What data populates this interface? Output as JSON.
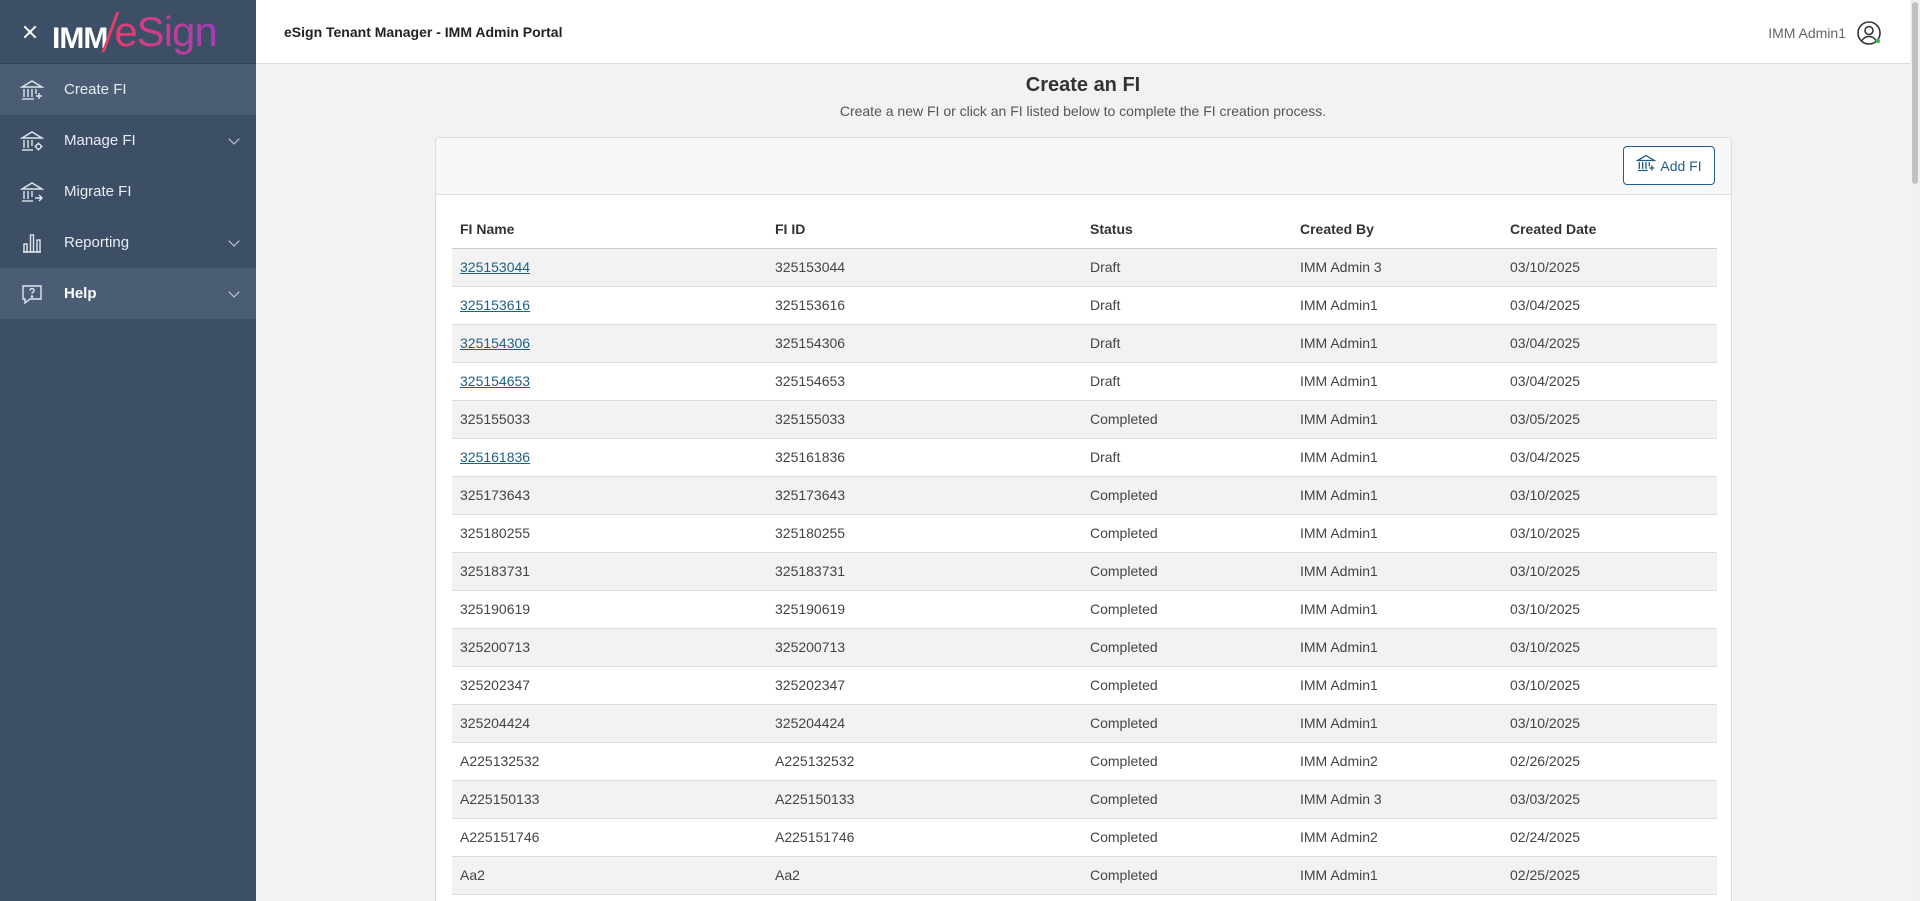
{
  "sidebar": {
    "logo_imm": "IMM",
    "logo_esign": "eSign",
    "items": [
      {
        "label": "Create FI",
        "icon": "bank-add-icon"
      },
      {
        "label": "Manage FI",
        "icon": "bank-gear-icon"
      },
      {
        "label": "Migrate FI",
        "icon": "bank-arrow-icon"
      },
      {
        "label": "Reporting",
        "icon": "bar-chart-icon"
      },
      {
        "label": "Help",
        "icon": "help-icon"
      }
    ]
  },
  "header": {
    "title": "eSign Tenant Manager - IMM Admin Portal",
    "user": "IMM Admin1"
  },
  "page": {
    "title": "Create an FI",
    "subtitle": "Create a new FI or click an FI listed below to complete the FI creation process.",
    "add_button": "Add FI"
  },
  "table": {
    "columns": [
      "FI Name",
      "FI ID",
      "Status",
      "Created By",
      "Created Date"
    ],
    "rows": [
      {
        "name": "325153044",
        "id": "325153044",
        "status": "Draft",
        "by": "IMM Admin 3",
        "date": "03/10/2025",
        "link": true
      },
      {
        "name": "325153616",
        "id": "325153616",
        "status": "Draft",
        "by": "IMM Admin1",
        "date": "03/04/2025",
        "link": true
      },
      {
        "name": "325154306",
        "id": "325154306",
        "status": "Draft",
        "by": "IMM Admin1",
        "date": "03/04/2025",
        "link": true
      },
      {
        "name": "325154653",
        "id": "325154653",
        "status": "Draft",
        "by": "IMM Admin1",
        "date": "03/04/2025",
        "link": true
      },
      {
        "name": "325155033",
        "id": "325155033",
        "status": "Completed",
        "by": "IMM Admin1",
        "date": "03/05/2025",
        "link": false
      },
      {
        "name": "325161836",
        "id": "325161836",
        "status": "Draft",
        "by": "IMM Admin1",
        "date": "03/04/2025",
        "link": true
      },
      {
        "name": "325173643",
        "id": "325173643",
        "status": "Completed",
        "by": "IMM Admin1",
        "date": "03/10/2025",
        "link": false
      },
      {
        "name": "325180255",
        "id": "325180255",
        "status": "Completed",
        "by": "IMM Admin1",
        "date": "03/10/2025",
        "link": false
      },
      {
        "name": "325183731",
        "id": "325183731",
        "status": "Completed",
        "by": "IMM Admin1",
        "date": "03/10/2025",
        "link": false
      },
      {
        "name": "325190619",
        "id": "325190619",
        "status": "Completed",
        "by": "IMM Admin1",
        "date": "03/10/2025",
        "link": false
      },
      {
        "name": "325200713",
        "id": "325200713",
        "status": "Completed",
        "by": "IMM Admin1",
        "date": "03/10/2025",
        "link": false
      },
      {
        "name": "325202347",
        "id": "325202347",
        "status": "Completed",
        "by": "IMM Admin1",
        "date": "03/10/2025",
        "link": false
      },
      {
        "name": "325204424",
        "id": "325204424",
        "status": "Completed",
        "by": "IMM Admin1",
        "date": "03/10/2025",
        "link": false
      },
      {
        "name": "A225132532",
        "id": "A225132532",
        "status": "Completed",
        "by": "IMM Admin2",
        "date": "02/26/2025",
        "link": false
      },
      {
        "name": "A225150133",
        "id": "A225150133",
        "status": "Completed",
        "by": "IMM Admin 3",
        "date": "03/03/2025",
        "link": false
      },
      {
        "name": "A225151746",
        "id": "A225151746",
        "status": "Completed",
        "by": "IMM Admin2",
        "date": "02/24/2025",
        "link": false
      },
      {
        "name": "Aa2",
        "id": "Aa2",
        "status": "Completed",
        "by": "IMM Admin1",
        "date": "02/25/2025",
        "link": false
      }
    ]
  },
  "colors": {
    "sidebar_bg": "#3d4f66",
    "sidebar_active": "#4b5d75",
    "link": "#1d5f8a",
    "logo_gradient_start": "#e63c6e",
    "logo_gradient_end": "#a23fb8"
  }
}
